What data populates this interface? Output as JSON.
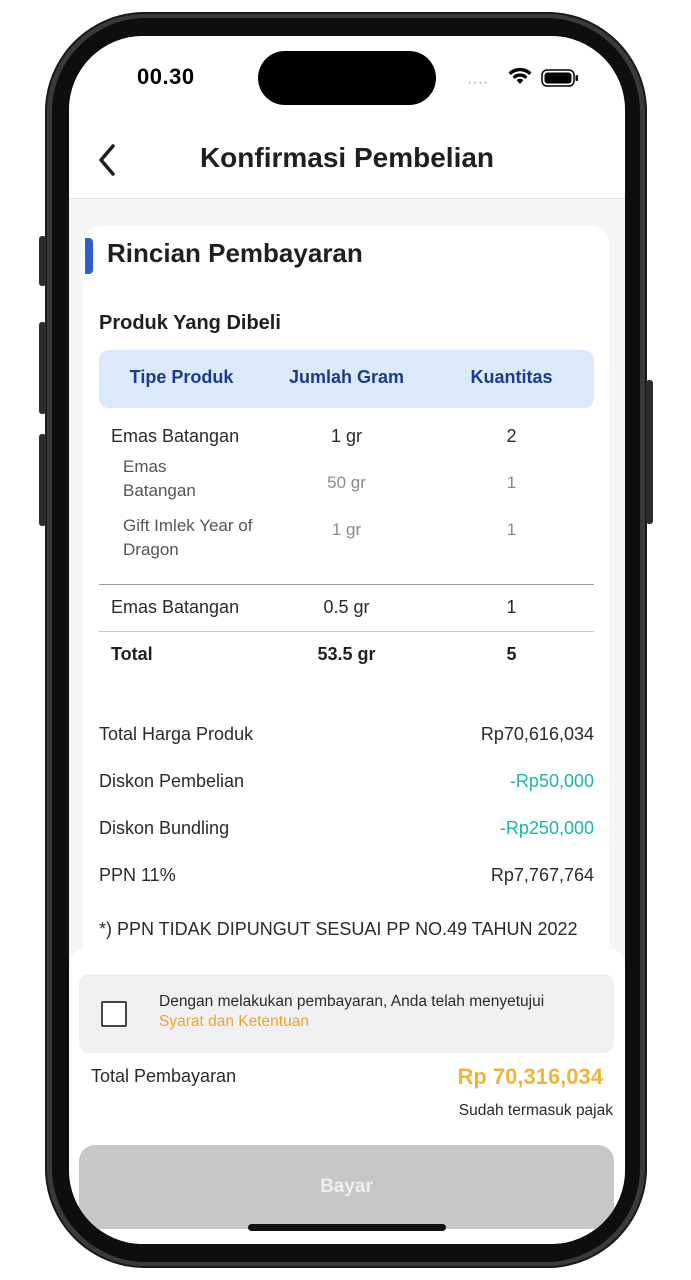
{
  "status_bar": {
    "time": "00.30"
  },
  "header": {
    "title": "Konfirmasi Pembelian"
  },
  "card": {
    "section_title": "Rincian Pembayaran",
    "subsection_title": "Produk Yang Dibeli",
    "table": {
      "headers": [
        "Tipe Produk",
        "Jumlah Gram",
        "Kuantitas"
      ],
      "rows": [
        {
          "type": "Emas Batangan",
          "gram": "1 gr",
          "qty": "2"
        },
        {
          "type": "Emas Batangan",
          "gram": "50 gr",
          "qty": "1"
        },
        {
          "type": "Gift Imlek Year of Dragon",
          "gram": "1 gr",
          "qty": "1"
        },
        {
          "type": "Emas Batangan",
          "gram": "0.5 gr",
          "qty": "1"
        }
      ],
      "total": {
        "label": "Total",
        "gram": "53.5 gr",
        "qty": "5"
      }
    },
    "summary": [
      {
        "label": "Total Harga Produk",
        "value": "Rp70,616,034"
      },
      {
        "label": "Diskon Pembelian",
        "value": "-Rp50,000"
      },
      {
        "label": "Diskon Bundling",
        "value": "-Rp250,000"
      },
      {
        "label": "PPN 11%",
        "value": "Rp7,767,764"
      }
    ],
    "note": "*) PPN TIDAK DIPUNGUT SESUAI PP NO.49 TAHUN 2022"
  },
  "footer": {
    "agreement_text": "Dengan melakukan pembayaran, Anda telah menyetujui",
    "agreement_link": "Syarat dan Ketentuan",
    "agreement_checked": false,
    "total_label": "Total Pembayaran",
    "total_value": "Rp 70,316,034",
    "tax_note": "Sudah termasuk pajak",
    "pay_button": "Bayar"
  },
  "colors": {
    "accent": "#2d5fc4",
    "table_header_bg": "#dbe9fb",
    "discount_text": "#1bb5a8",
    "link_and_total": "#f0b43a",
    "button_disabled": "#c7c7c9"
  }
}
